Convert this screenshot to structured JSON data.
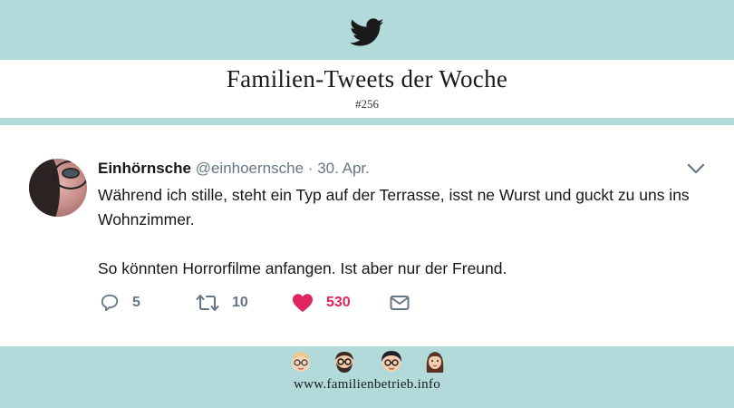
{
  "header": {
    "brand_icon": "twitter-bird-icon",
    "title": "Familien-Tweets der Woche",
    "subtitle": "#256"
  },
  "tweet": {
    "author_name": "Einhörnsche",
    "author_handle": "@einhoernsche",
    "separator": "·",
    "date": "30. Apr.",
    "text_line_1": "Während ich stille, steht ein Typ auf der Terrasse,  isst ne Wurst und guckt zu uns ins Wohnzimmer.",
    "text_line_2": "So könnten Horrorfilme anfangen. Ist aber nur der Freund.",
    "replies": "5",
    "retweets": "10",
    "likes": "530",
    "like_color": "#e0245e"
  },
  "footer": {
    "website": "www.familienbetrieb.info",
    "faces": [
      "face-blond-glasses-icon",
      "face-bearded-glasses-icon",
      "face-dark-hair-glasses-icon",
      "face-long-hair-icon"
    ]
  },
  "colors": {
    "band": "#b3dadb",
    "text": "#14171a",
    "muted": "#657786"
  }
}
